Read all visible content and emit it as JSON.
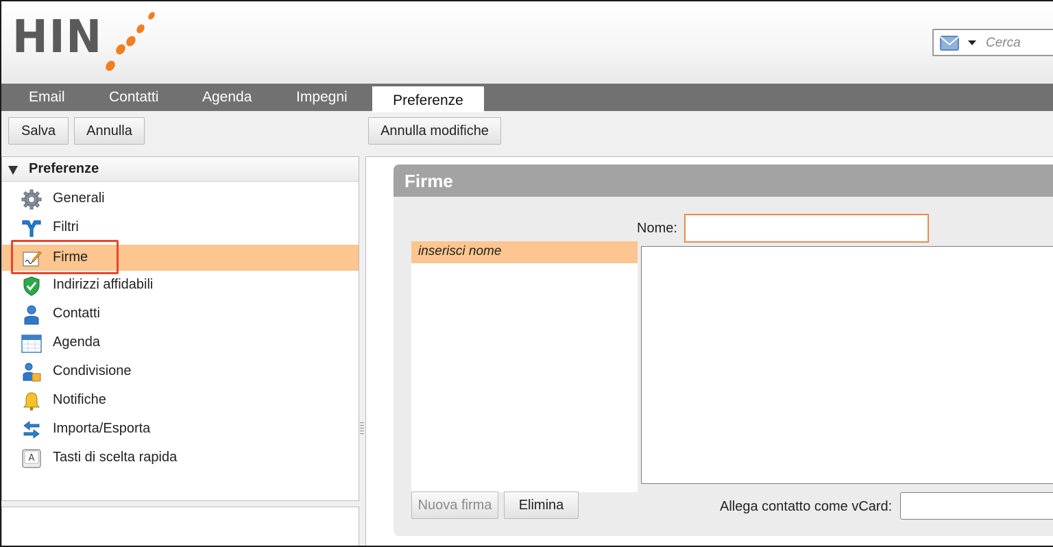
{
  "header": {
    "logo_text": "HIN",
    "search": {
      "placeholder": "Cerca"
    }
  },
  "tabs": [
    {
      "label": "Email"
    },
    {
      "label": "Contatti"
    },
    {
      "label": "Agenda"
    },
    {
      "label": "Impegni"
    },
    {
      "label": "Preferenze",
      "active": true
    }
  ],
  "toolbar": {
    "save_label": "Salva",
    "cancel_label": "Annulla",
    "revert_label": "Annulla modifiche"
  },
  "sidebar": {
    "title": "Preferenze",
    "items": [
      {
        "label": "Generali",
        "icon": "gear-icon"
      },
      {
        "label": "Filtri",
        "icon": "filter-icon"
      },
      {
        "label": "Firme",
        "icon": "signature-icon",
        "selected": true
      },
      {
        "label": "Indirizzi affidabili",
        "icon": "shield-check-icon"
      },
      {
        "label": "Contatti",
        "icon": "person-icon"
      },
      {
        "label": "Agenda",
        "icon": "calendar-icon"
      },
      {
        "label": "Condivisione",
        "icon": "sharing-icon"
      },
      {
        "label": "Notifiche",
        "icon": "bell-icon"
      },
      {
        "label": "Importa/Esporta",
        "icon": "import-export-icon"
      },
      {
        "label": "Tasti di scelta rapida",
        "icon": "keyboard-key-icon"
      }
    ]
  },
  "firme": {
    "title": "Firme",
    "list": [
      "inserisci nome"
    ],
    "nome_label": "Nome:",
    "nome_value": "",
    "new_label": "Nuova firma",
    "delete_label": "Elimina",
    "vcard_label": "Allega contatto come vCard:"
  },
  "colors": {
    "selection": "#fdc58f",
    "tabbar": "#717171",
    "logo_accent": "#f07f22",
    "highlight_box": "#e8452c"
  }
}
